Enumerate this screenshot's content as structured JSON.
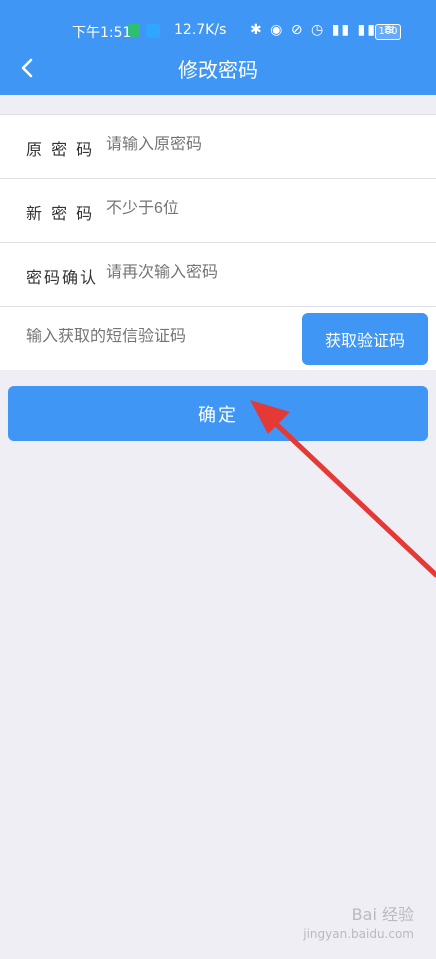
{
  "status_bar": {
    "time": "下午1:51",
    "network_speed": "12.7K/s",
    "battery_level": "100"
  },
  "header": {
    "title": "修改密码",
    "back_icon": "chevron-left-icon"
  },
  "form": {
    "old_password": {
      "label": "原 密 码",
      "placeholder": "请输入原密码"
    },
    "new_password": {
      "label": "新 密 码",
      "placeholder": "不少于6位"
    },
    "confirm_password": {
      "label": "密码确认",
      "placeholder": "请再次输入密码"
    },
    "sms_code": {
      "placeholder": "输入获取的短信验证码",
      "button_label": "获取验证码"
    }
  },
  "confirm_button": {
    "label": "确定"
  },
  "watermark": {
    "text": "Bai 经验",
    "url": "jingyan.baidu.com"
  },
  "colors": {
    "primary": "#3f96f5",
    "background": "#efeef4",
    "annotation_arrow": "#e53935"
  }
}
